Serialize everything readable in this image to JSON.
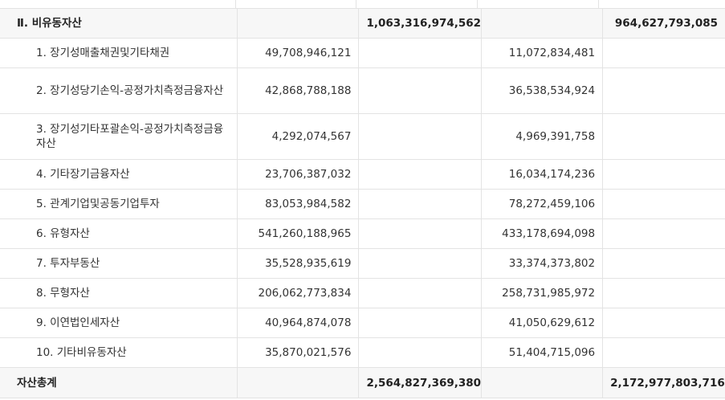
{
  "section": {
    "label": "Ⅱ. 비유동자산",
    "col2": "1,063,316,974,562",
    "col4": "964,627,793,085"
  },
  "rows": [
    {
      "label": "1. 장기성매출채권및기타채권",
      "col1": "49,708,946,121",
      "col3": "11,072,834,481"
    },
    {
      "label": "2. 장기성당기손익-공정가치측정금융자산",
      "col1": "42,868,788,188",
      "col3": "36,538,534,924"
    },
    {
      "label": "3. 장기성기타포괄손익-공정가치측정금융자산",
      "col1": "4,292,074,567",
      "col3": "4,969,391,758"
    },
    {
      "label": "4. 기타장기금융자산",
      "col1": "23,706,387,032",
      "col3": "16,034,174,236"
    },
    {
      "label": "5. 관계기업및공동기업투자",
      "col1": "83,053,984,582",
      "col3": "78,272,459,106"
    },
    {
      "label": "6. 유형자산",
      "col1": "541,260,188,965",
      "col3": "433,178,694,098"
    },
    {
      "label": "7. 투자부동산",
      "col1": "35,528,935,619",
      "col3": "33,374,373,802"
    },
    {
      "label": "8. 무형자산",
      "col1": "206,062,773,834",
      "col3": "258,731,985,972"
    },
    {
      "label": "9. 이연법인세자산",
      "col1": "40,964,874,078",
      "col3": "41,050,629,612"
    },
    {
      "label": "10. 기타비유동자산",
      "col1": "35,870,021,576",
      "col3": "51,404,715,096"
    }
  ],
  "total": {
    "label": "자산총계",
    "col2": "2,564,827,369,380",
    "col4": "2,172,977,803,716"
  }
}
